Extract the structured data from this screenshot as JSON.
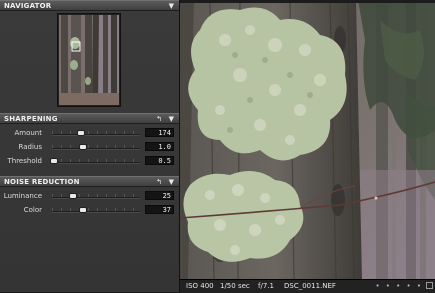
{
  "navigator": {
    "title": "NAVIGATOR",
    "menu_icon": "triangle-down-icon"
  },
  "sharpening": {
    "title": "SHARPENING",
    "reset_icon": "reset-arrow-icon",
    "menu_icon": "triangle-down-icon",
    "rows": [
      {
        "label": "Amount",
        "value": "174",
        "level": 0.35
      },
      {
        "label": "Radius",
        "value": "1.0",
        "level": 0.38
      },
      {
        "label": "Threshold",
        "value": "0.5",
        "level": 0.02
      }
    ]
  },
  "noise_reduction": {
    "title": "NOISE REDUCTION",
    "reset_icon": "reset-arrow-icon",
    "menu_icon": "triangle-down-icon",
    "rows": [
      {
        "label": "Luminance",
        "value": "25",
        "level": 0.25
      },
      {
        "label": "Color",
        "value": "37",
        "level": 0.37
      }
    ]
  },
  "status": {
    "iso": "ISO 400",
    "shutter": "1/50 sec",
    "aperture": "f/7.1",
    "filename": "DSC_0011.NEF",
    "dots": "• • • • •"
  },
  "colors": {
    "panel_bg": "#383838",
    "header_bg": "#4d4d4d",
    "lichen": "#b9c6a6",
    "bark": "#5b5550"
  }
}
